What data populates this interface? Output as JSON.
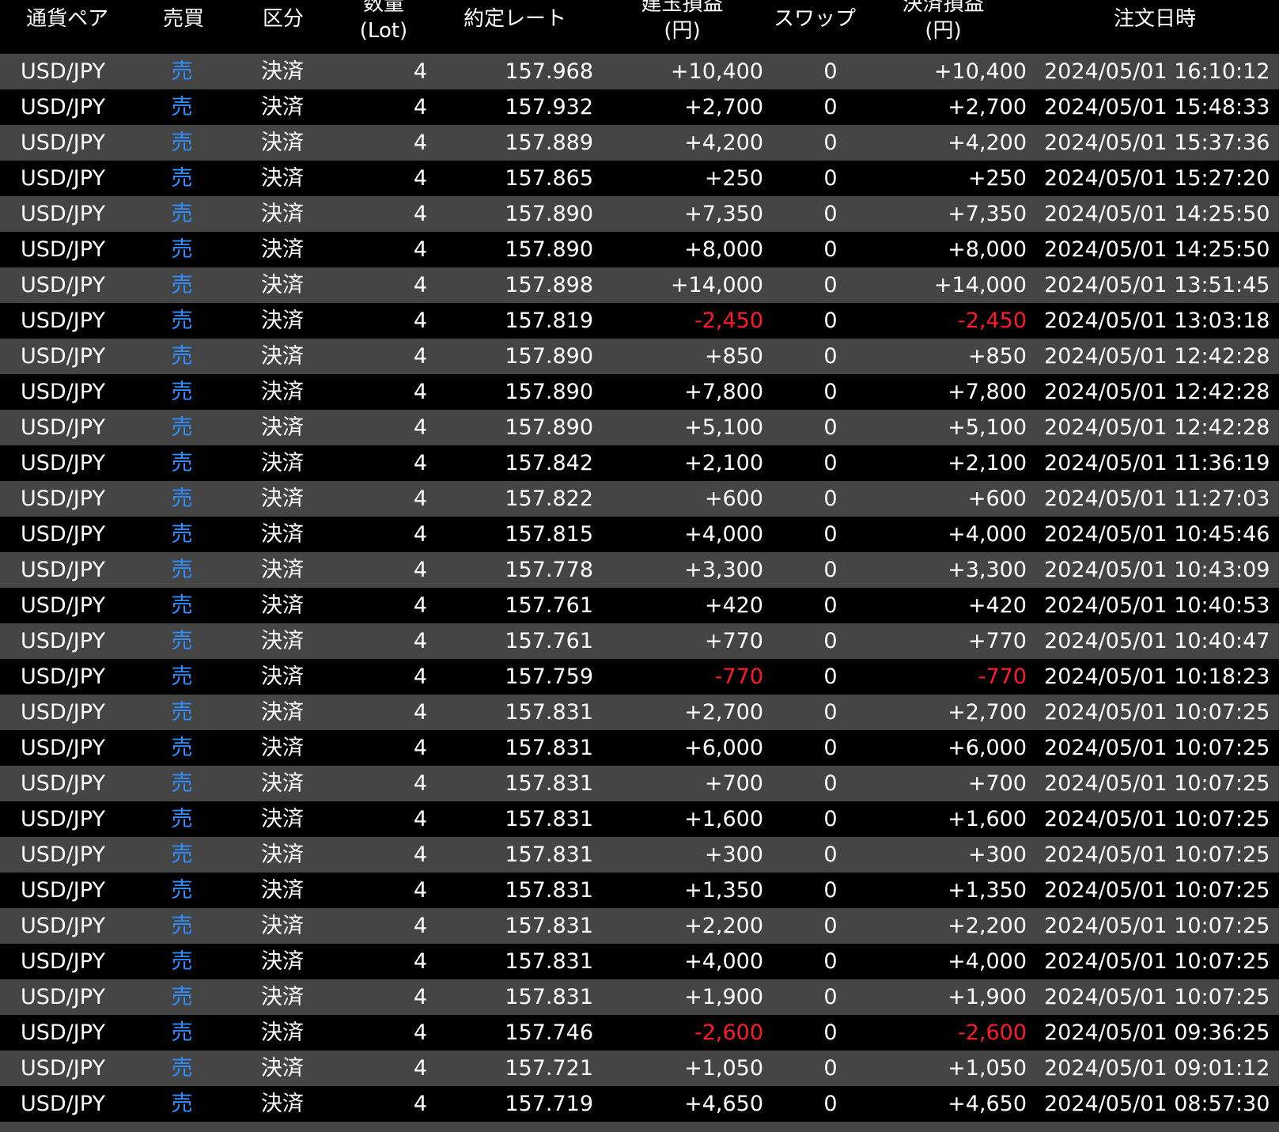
{
  "colors": {
    "odd_row_bg": "#454545",
    "even_row_bg": "#000000",
    "sell_text": "#2f8fff",
    "negative_text": "#ff1a2e",
    "text": "#ffffff"
  },
  "header": {
    "pair": "通貨ペア",
    "side": "売買",
    "kind": "区分",
    "qty_line1": "数量",
    "qty_line2": "(Lot)",
    "rate": "約定レート",
    "pl_line1": "建玉損益",
    "pl_line2": "(円)",
    "swap": "スワップ",
    "settle_pl_line1": "決済損益",
    "settle_pl_line2": "(円)",
    "order_datetime": "注文日時"
  },
  "rows": [
    {
      "pair": "USD/JPY",
      "side": "売",
      "kind": "決済",
      "qty": "4",
      "rate": "157.968",
      "pl": "+10,400",
      "swap": "0",
      "settle_pl": "+10,400",
      "datetime": "2024/05/01 16:10:12"
    },
    {
      "pair": "USD/JPY",
      "side": "売",
      "kind": "決済",
      "qty": "4",
      "rate": "157.932",
      "pl": "+2,700",
      "swap": "0",
      "settle_pl": "+2,700",
      "datetime": "2024/05/01 15:48:33"
    },
    {
      "pair": "USD/JPY",
      "side": "売",
      "kind": "決済",
      "qty": "4",
      "rate": "157.889",
      "pl": "+4,200",
      "swap": "0",
      "settle_pl": "+4,200",
      "datetime": "2024/05/01 15:37:36"
    },
    {
      "pair": "USD/JPY",
      "side": "売",
      "kind": "決済",
      "qty": "4",
      "rate": "157.865",
      "pl": "+250",
      "swap": "0",
      "settle_pl": "+250",
      "datetime": "2024/05/01 15:27:20"
    },
    {
      "pair": "USD/JPY",
      "side": "売",
      "kind": "決済",
      "qty": "4",
      "rate": "157.890",
      "pl": "+7,350",
      "swap": "0",
      "settle_pl": "+7,350",
      "datetime": "2024/05/01 14:25:50"
    },
    {
      "pair": "USD/JPY",
      "side": "売",
      "kind": "決済",
      "qty": "4",
      "rate": "157.890",
      "pl": "+8,000",
      "swap": "0",
      "settle_pl": "+8,000",
      "datetime": "2024/05/01 14:25:50"
    },
    {
      "pair": "USD/JPY",
      "side": "売",
      "kind": "決済",
      "qty": "4",
      "rate": "157.898",
      "pl": "+14,000",
      "swap": "0",
      "settle_pl": "+14,000",
      "datetime": "2024/05/01 13:51:45"
    },
    {
      "pair": "USD/JPY",
      "side": "売",
      "kind": "決済",
      "qty": "4",
      "rate": "157.819",
      "pl": "-2,450",
      "swap": "0",
      "settle_pl": "-2,450",
      "datetime": "2024/05/01 13:03:18"
    },
    {
      "pair": "USD/JPY",
      "side": "売",
      "kind": "決済",
      "qty": "4",
      "rate": "157.890",
      "pl": "+850",
      "swap": "0",
      "settle_pl": "+850",
      "datetime": "2024/05/01 12:42:28"
    },
    {
      "pair": "USD/JPY",
      "side": "売",
      "kind": "決済",
      "qty": "4",
      "rate": "157.890",
      "pl": "+7,800",
      "swap": "0",
      "settle_pl": "+7,800",
      "datetime": "2024/05/01 12:42:28"
    },
    {
      "pair": "USD/JPY",
      "side": "売",
      "kind": "決済",
      "qty": "4",
      "rate": "157.890",
      "pl": "+5,100",
      "swap": "0",
      "settle_pl": "+5,100",
      "datetime": "2024/05/01 12:42:28"
    },
    {
      "pair": "USD/JPY",
      "side": "売",
      "kind": "決済",
      "qty": "4",
      "rate": "157.842",
      "pl": "+2,100",
      "swap": "0",
      "settle_pl": "+2,100",
      "datetime": "2024/05/01 11:36:19"
    },
    {
      "pair": "USD/JPY",
      "side": "売",
      "kind": "決済",
      "qty": "4",
      "rate": "157.822",
      "pl": "+600",
      "swap": "0",
      "settle_pl": "+600",
      "datetime": "2024/05/01 11:27:03"
    },
    {
      "pair": "USD/JPY",
      "side": "売",
      "kind": "決済",
      "qty": "4",
      "rate": "157.815",
      "pl": "+4,000",
      "swap": "0",
      "settle_pl": "+4,000",
      "datetime": "2024/05/01 10:45:46"
    },
    {
      "pair": "USD/JPY",
      "side": "売",
      "kind": "決済",
      "qty": "4",
      "rate": "157.778",
      "pl": "+3,300",
      "swap": "0",
      "settle_pl": "+3,300",
      "datetime": "2024/05/01 10:43:09"
    },
    {
      "pair": "USD/JPY",
      "side": "売",
      "kind": "決済",
      "qty": "4",
      "rate": "157.761",
      "pl": "+420",
      "swap": "0",
      "settle_pl": "+420",
      "datetime": "2024/05/01 10:40:53"
    },
    {
      "pair": "USD/JPY",
      "side": "売",
      "kind": "決済",
      "qty": "4",
      "rate": "157.761",
      "pl": "+770",
      "swap": "0",
      "settle_pl": "+770",
      "datetime": "2024/05/01 10:40:47"
    },
    {
      "pair": "USD/JPY",
      "side": "売",
      "kind": "決済",
      "qty": "4",
      "rate": "157.759",
      "pl": "-770",
      "swap": "0",
      "settle_pl": "-770",
      "datetime": "2024/05/01 10:18:23"
    },
    {
      "pair": "USD/JPY",
      "side": "売",
      "kind": "決済",
      "qty": "4",
      "rate": "157.831",
      "pl": "+2,700",
      "swap": "0",
      "settle_pl": "+2,700",
      "datetime": "2024/05/01 10:07:25"
    },
    {
      "pair": "USD/JPY",
      "side": "売",
      "kind": "決済",
      "qty": "4",
      "rate": "157.831",
      "pl": "+6,000",
      "swap": "0",
      "settle_pl": "+6,000",
      "datetime": "2024/05/01 10:07:25"
    },
    {
      "pair": "USD/JPY",
      "side": "売",
      "kind": "決済",
      "qty": "4",
      "rate": "157.831",
      "pl": "+700",
      "swap": "0",
      "settle_pl": "+700",
      "datetime": "2024/05/01 10:07:25"
    },
    {
      "pair": "USD/JPY",
      "side": "売",
      "kind": "決済",
      "qty": "4",
      "rate": "157.831",
      "pl": "+1,600",
      "swap": "0",
      "settle_pl": "+1,600",
      "datetime": "2024/05/01 10:07:25"
    },
    {
      "pair": "USD/JPY",
      "side": "売",
      "kind": "決済",
      "qty": "4",
      "rate": "157.831",
      "pl": "+300",
      "swap": "0",
      "settle_pl": "+300",
      "datetime": "2024/05/01 10:07:25"
    },
    {
      "pair": "USD/JPY",
      "side": "売",
      "kind": "決済",
      "qty": "4",
      "rate": "157.831",
      "pl": "+1,350",
      "swap": "0",
      "settle_pl": "+1,350",
      "datetime": "2024/05/01 10:07:25"
    },
    {
      "pair": "USD/JPY",
      "side": "売",
      "kind": "決済",
      "qty": "4",
      "rate": "157.831",
      "pl": "+2,200",
      "swap": "0",
      "settle_pl": "+2,200",
      "datetime": "2024/05/01 10:07:25"
    },
    {
      "pair": "USD/JPY",
      "side": "売",
      "kind": "決済",
      "qty": "4",
      "rate": "157.831",
      "pl": "+4,000",
      "swap": "0",
      "settle_pl": "+4,000",
      "datetime": "2024/05/01 10:07:25"
    },
    {
      "pair": "USD/JPY",
      "side": "売",
      "kind": "決済",
      "qty": "4",
      "rate": "157.831",
      "pl": "+1,900",
      "swap": "0",
      "settle_pl": "+1,900",
      "datetime": "2024/05/01 10:07:25"
    },
    {
      "pair": "USD/JPY",
      "side": "売",
      "kind": "決済",
      "qty": "4",
      "rate": "157.746",
      "pl": "-2,600",
      "swap": "0",
      "settle_pl": "-2,600",
      "datetime": "2024/05/01 09:36:25"
    },
    {
      "pair": "USD/JPY",
      "side": "売",
      "kind": "決済",
      "qty": "4",
      "rate": "157.721",
      "pl": "+1,050",
      "swap": "0",
      "settle_pl": "+1,050",
      "datetime": "2024/05/01 09:01:12"
    },
    {
      "pair": "USD/JPY",
      "side": "売",
      "kind": "決済",
      "qty": "4",
      "rate": "157.719",
      "pl": "+4,650",
      "swap": "0",
      "settle_pl": "+4,650",
      "datetime": "2024/05/01 08:57:30"
    }
  ]
}
